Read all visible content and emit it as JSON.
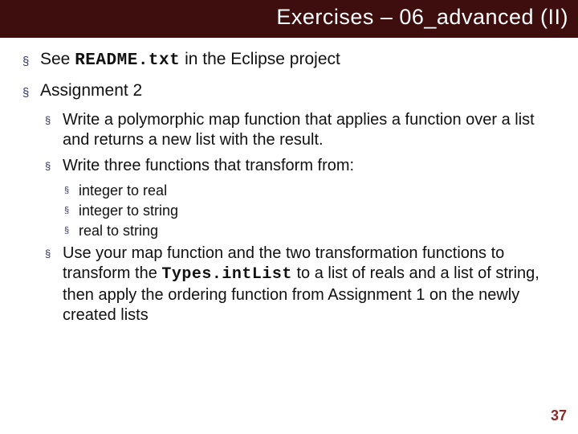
{
  "title": "Exercises – 06_advanced (II)",
  "bullets": {
    "see_pre": "See ",
    "readme": "README.txt",
    "see_post": " in the Eclipse project",
    "assign": "Assignment 2",
    "map_fn": "Write a polymorphic map function that applies a function over a list and returns a new list with the result.",
    "three_fn": "Write three functions that transform from:",
    "t1": "integer to real",
    "t2": "integer to string",
    "t3": "real to string",
    "use_pre": "Use your map function and the two transformation functions to transform the ",
    "types": "Types.intList",
    "use_post": " to a list of reals and a list of string, then apply the ordering function from Assignment 1 on the newly created lists"
  },
  "page_number": "37"
}
